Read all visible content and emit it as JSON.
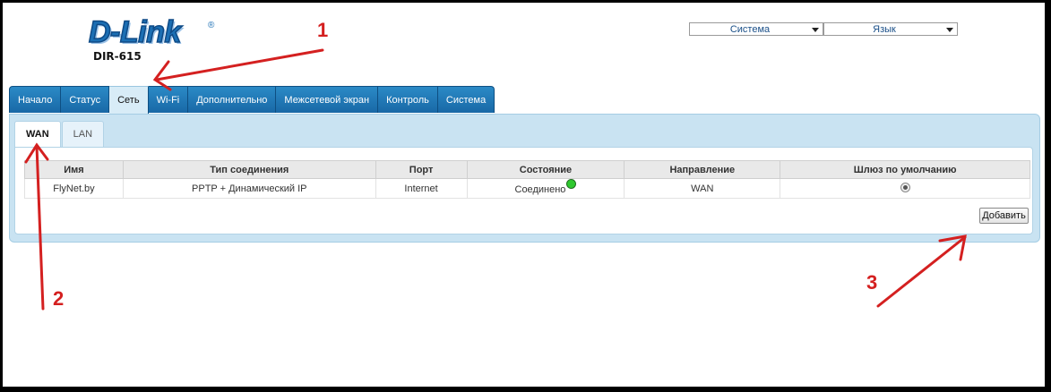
{
  "header": {
    "brand": "D-Link",
    "model": "DIR-615"
  },
  "top_selects": {
    "system": "Система",
    "language": "Язык"
  },
  "main_tabs": [
    {
      "label": "Начало"
    },
    {
      "label": "Статус"
    },
    {
      "label": "Сеть"
    },
    {
      "label": "Wi-Fi"
    },
    {
      "label": "Дополнительно"
    },
    {
      "label": "Межсетевой экран"
    },
    {
      "label": "Контроль"
    },
    {
      "label": "Система"
    }
  ],
  "sub_tabs": [
    {
      "label": "WAN"
    },
    {
      "label": "LAN"
    }
  ],
  "table": {
    "headers": [
      "Имя",
      "Тип соединения",
      "Порт",
      "Состояние",
      "Направление",
      "Шлюз по умолчанию"
    ],
    "rows": [
      [
        "FlyNet.by",
        "PPTP + Динамический IP",
        "Internet",
        "Соединено",
        "WAN",
        ""
      ]
    ]
  },
  "add_button": "Добавить",
  "annotations": [
    "1",
    "2",
    "3"
  ],
  "colors": {
    "accent": "#1868a6",
    "panel": "#c9e3f2",
    "annotation": "#d42020",
    "status_connected": "#2ec82e"
  }
}
